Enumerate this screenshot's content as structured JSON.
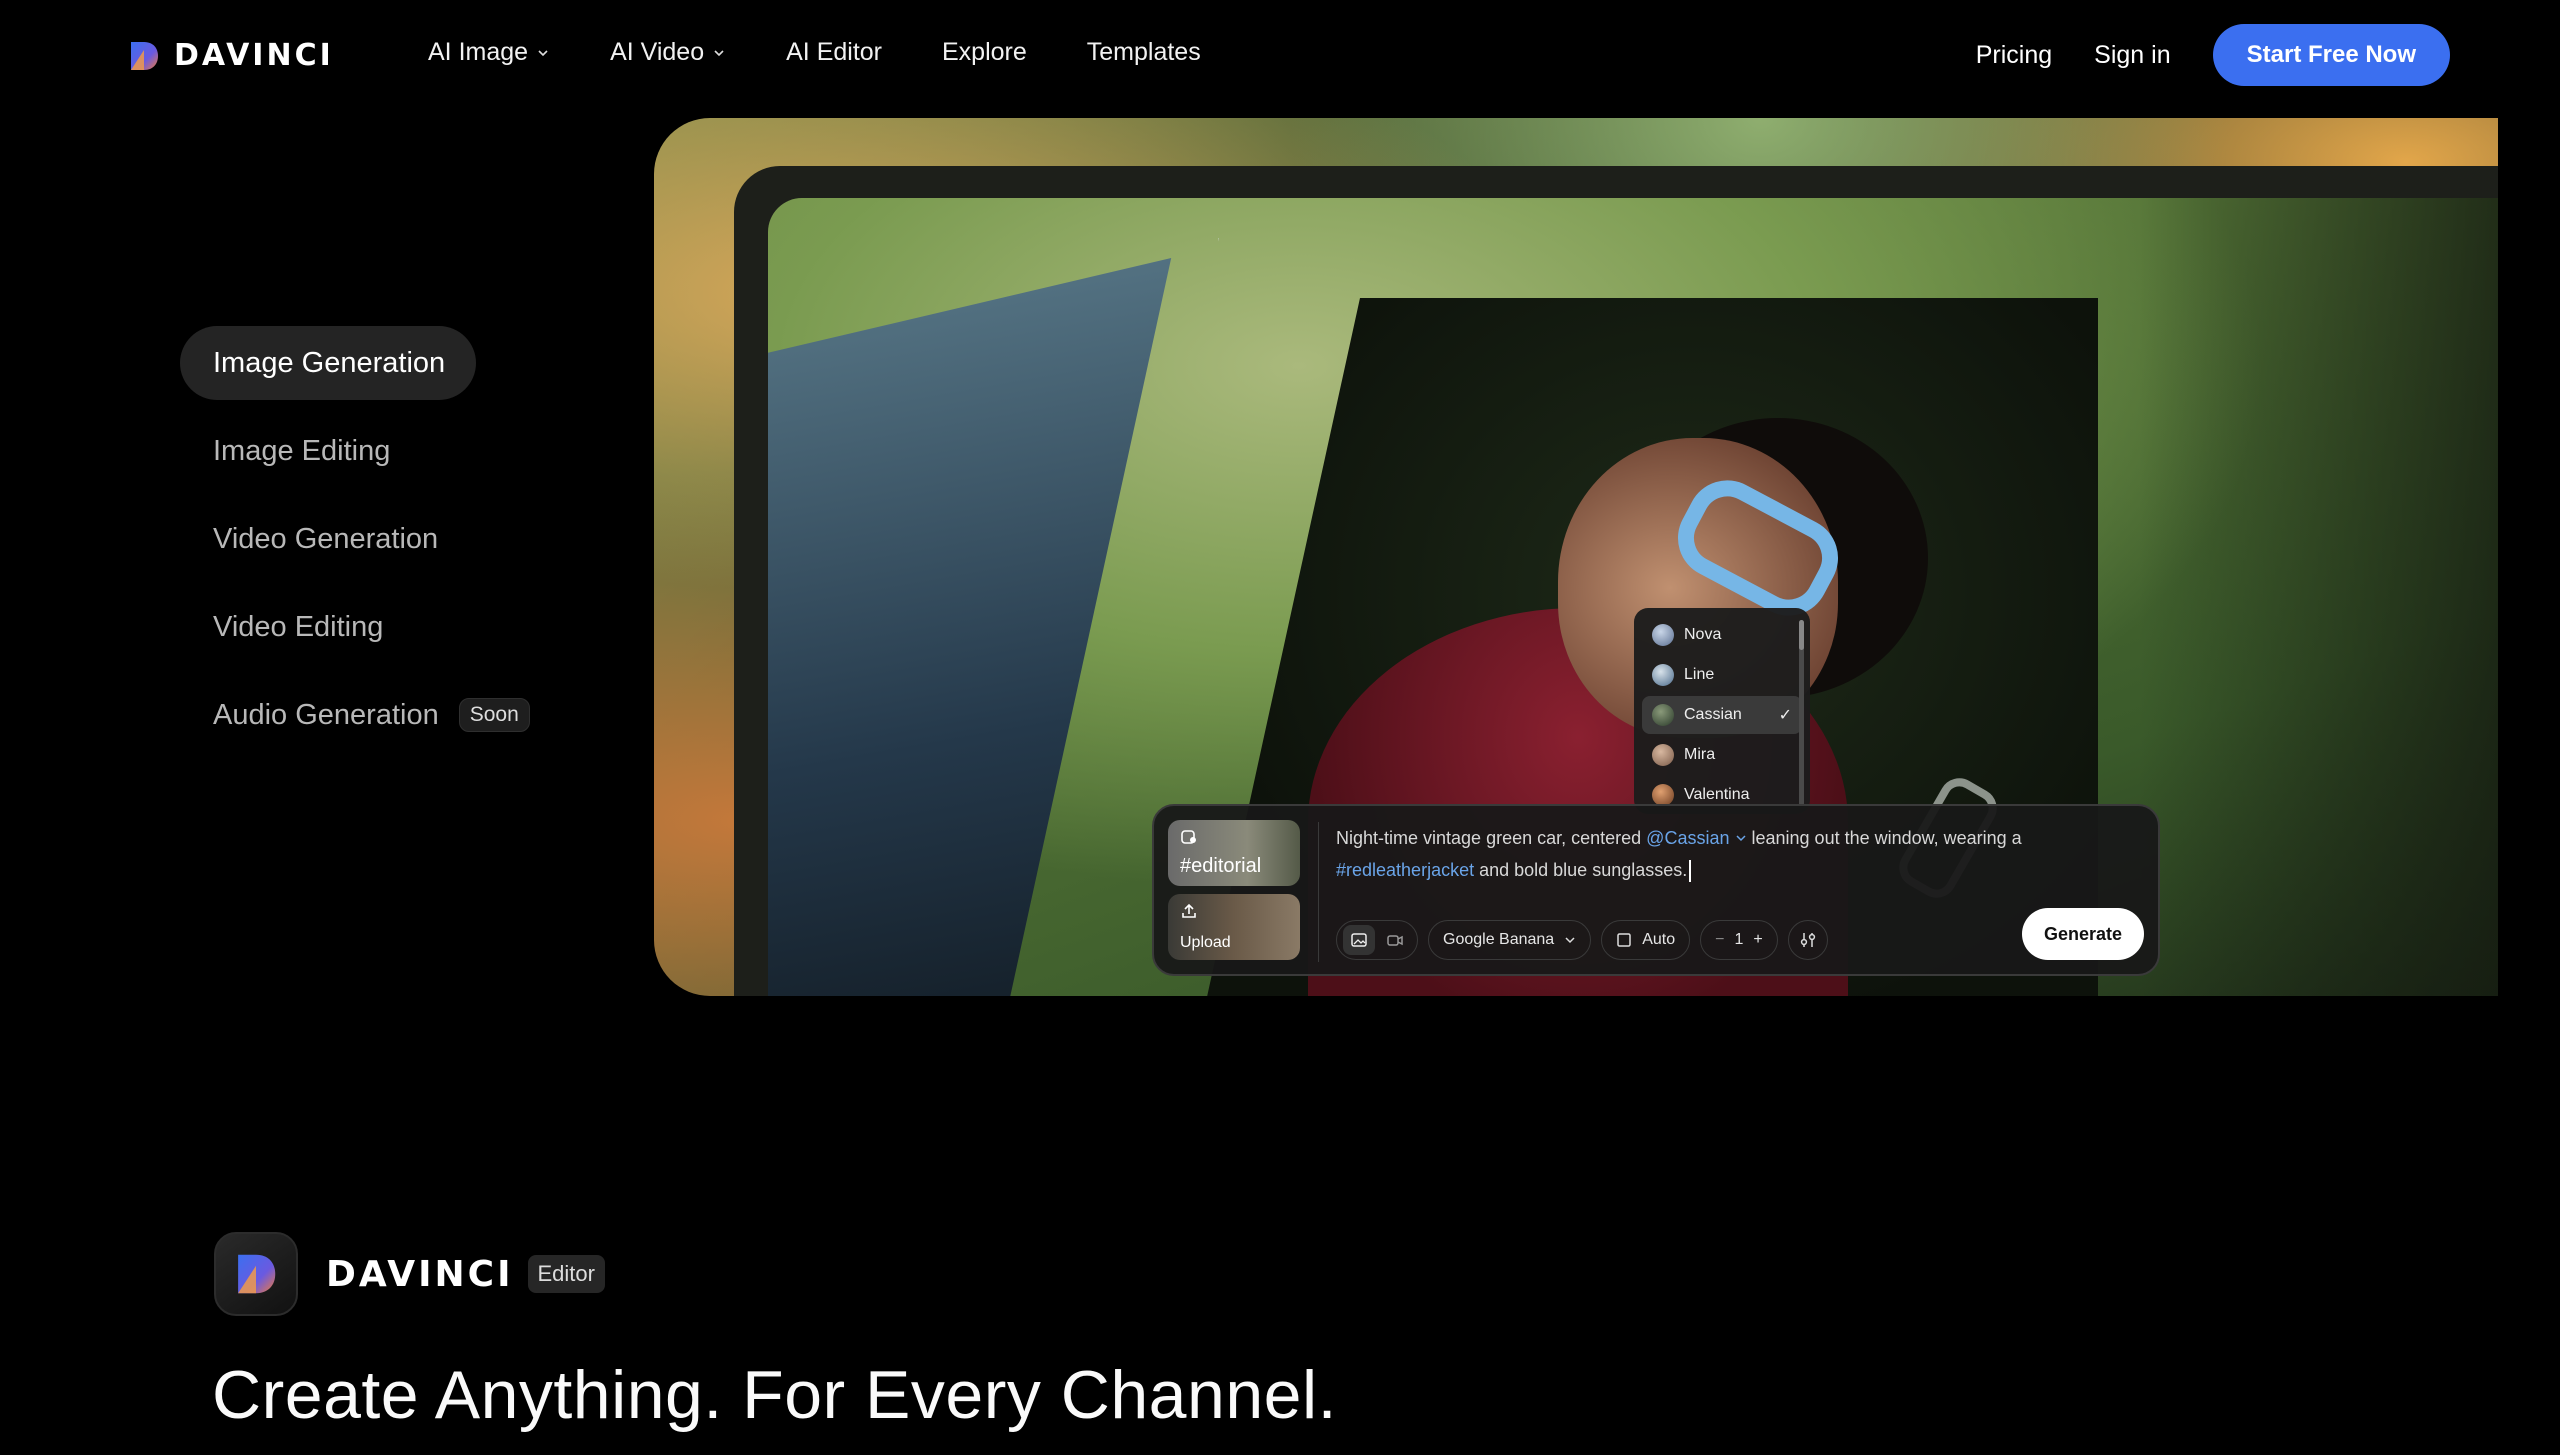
{
  "brand": {
    "name": "DAVINCI",
    "logo_icon": "davinci-logo-icon"
  },
  "nav": {
    "links": [
      {
        "label": "AI Image",
        "dropdown": true
      },
      {
        "label": "AI Video",
        "dropdown": true
      },
      {
        "label": "AI Editor",
        "dropdown": false
      },
      {
        "label": "Explore",
        "dropdown": false
      },
      {
        "label": "Templates",
        "dropdown": false
      }
    ],
    "pricing": "Pricing",
    "sign_in": "Sign in",
    "cta": "Start Free Now"
  },
  "colors": {
    "accent": "#3b6ff0",
    "mention": "#6aa4e8",
    "background": "#000000"
  },
  "side_menu": {
    "items": [
      {
        "label": "Image Generation",
        "active": true
      },
      {
        "label": "Image Editing"
      },
      {
        "label": "Video Generation"
      },
      {
        "label": "Video Editing"
      },
      {
        "label": "Audio Generation",
        "badge": "Soon"
      }
    ]
  },
  "dropdown": {
    "items": [
      {
        "label": "Nova",
        "selected": false
      },
      {
        "label": "Line",
        "selected": false
      },
      {
        "label": "Cassian",
        "selected": true
      },
      {
        "label": "Mira",
        "selected": false
      },
      {
        "label": "Valentina",
        "selected": false
      }
    ]
  },
  "prompt": {
    "thumb1_label": "#editorial",
    "thumb2_label": "Upload",
    "text_before": "Night-time vintage green car, centered ",
    "mention": "@Cassian",
    "text_middle": " leaning out the window, wearing a ",
    "hashtag": "#redleatherjacket",
    "text_after": " and bold blue sunglasses.",
    "model": "Google Banana",
    "aspect": "Auto",
    "count": "1",
    "minus": "−",
    "plus": "+",
    "generate": "Generate"
  },
  "product": {
    "name": "DAVINCI",
    "badge": "Editor"
  },
  "headline": "Create Anything. For Every Channel."
}
